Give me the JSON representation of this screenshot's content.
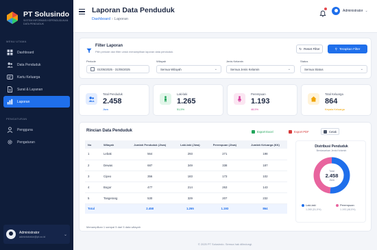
{
  "brand": {
    "name": "PT Solusindo",
    "subtitle": "SISTEM INFORMASI KEPENDUDUKAN DATA PENDUDUK"
  },
  "sidebar": {
    "section_main": "MENU UTAMA",
    "section_admin": "PENGATURAN",
    "items": [
      {
        "label": "Dashboard",
        "icon": "grid-icon",
        "active": false
      },
      {
        "label": "Data Penduduk",
        "icon": "users-icon",
        "active": false
      },
      {
        "label": "Kartu Keluarga",
        "icon": "card-icon",
        "active": false
      },
      {
        "label": "Surat & Layanan",
        "icon": "document-icon",
        "active": false
      },
      {
        "label": "Laporan",
        "icon": "chart-icon",
        "active": true
      }
    ],
    "admin_items": [
      {
        "label": "Pengguna",
        "icon": "user-icon"
      },
      {
        "label": "Pengaturan",
        "icon": "gear-icon"
      }
    ],
    "user": {
      "name": "Administrator",
      "role": "administrator@pt.co.id"
    }
  },
  "header": {
    "title": "Laporan Data Penduduk",
    "breadcrumb": [
      "Dashboard",
      "Laporan"
    ],
    "user_name": "Administrator"
  },
  "filter": {
    "title": "Filter Laporan",
    "description": "Pilih periode dan filter untuk menampilkan laporan data penduduk.",
    "reset_label": "Reset Filter",
    "apply_label": "Terapkan Filter",
    "fields": [
      {
        "label": "Periode",
        "value": "01/05/2025 - 31/05/2025"
      },
      {
        "label": "Wilayah",
        "value": "Semua Wilayah"
      },
      {
        "label": "Jenis Kelamin",
        "value": "Semua Jenis Kelamin"
      },
      {
        "label": "Status",
        "value": "Semua Status"
      }
    ]
  },
  "stats": [
    {
      "label": "Total Penduduk",
      "value": "2.458",
      "sub": "Jiwa",
      "color": "#1f6feb",
      "bg": "#e3edff",
      "icon": "users-icon"
    },
    {
      "label": "Laki-laki",
      "value": "1.265",
      "sub": "51,5%",
      "color": "#22a55b",
      "bg": "#e2f6ea",
      "icon": "male-icon"
    },
    {
      "label": "Perempuan",
      "value": "1.193",
      "sub": "48,5%",
      "color": "#d63d9b",
      "bg": "#fbe6f2",
      "icon": "female-icon"
    },
    {
      "label": "Total Keluarga",
      "value": "864",
      "sub": "Kepala Keluarga",
      "color": "#f0a400",
      "bg": "#fff3d9",
      "icon": "house-icon"
    }
  ],
  "table": {
    "title": "Rincian Data Penduduk",
    "export_excel": "Export Excel",
    "export_pdf": "Export PDF",
    "print": "Cetak",
    "columns": [
      "No",
      "Wilayah",
      "Jumlah Penduduk (Jiwa)",
      "Laki-laki (Jiwa)",
      "Perempuan (Jiwa)",
      "Jumlah Keluarga (KK)"
    ],
    "rows": [
      [
        "1",
        "Lebak",
        "564",
        "293",
        "271",
        "198"
      ],
      [
        "2",
        "Dewas",
        "687",
        "349",
        "338",
        "187"
      ],
      [
        "3",
        "Cipeo",
        "356",
        "183",
        "173",
        "102"
      ],
      [
        "4",
        "Bogor",
        "477",
        "214",
        "263",
        "143"
      ],
      [
        "5",
        "Tangerang",
        "530",
        "329",
        "207",
        "232"
      ]
    ],
    "total": [
      "Total",
      "",
      "2.458",
      "1.265",
      "1.193",
      "864"
    ],
    "footnote": "Menampilkan 1 sampai 5 dari 5 data wilayah"
  },
  "donut": {
    "title": "Distribusi Penduduk",
    "subtitle": "Berdasarkan Jenis Kelamin",
    "center_label": "Total",
    "center_value": "2.458",
    "center_unit": "Jiwa",
    "segments": [
      {
        "name": "Laki-laki",
        "value": 1265,
        "detail": "1.265 (51,5%)",
        "color": "#1f6feb"
      },
      {
        "name": "Perempuan",
        "value": 1193,
        "detail": "1.193 (48,5%)",
        "color": "#e8649e"
      }
    ]
  },
  "footer": "© 2025 PT Solusindo. Semua hak dilindungi."
}
